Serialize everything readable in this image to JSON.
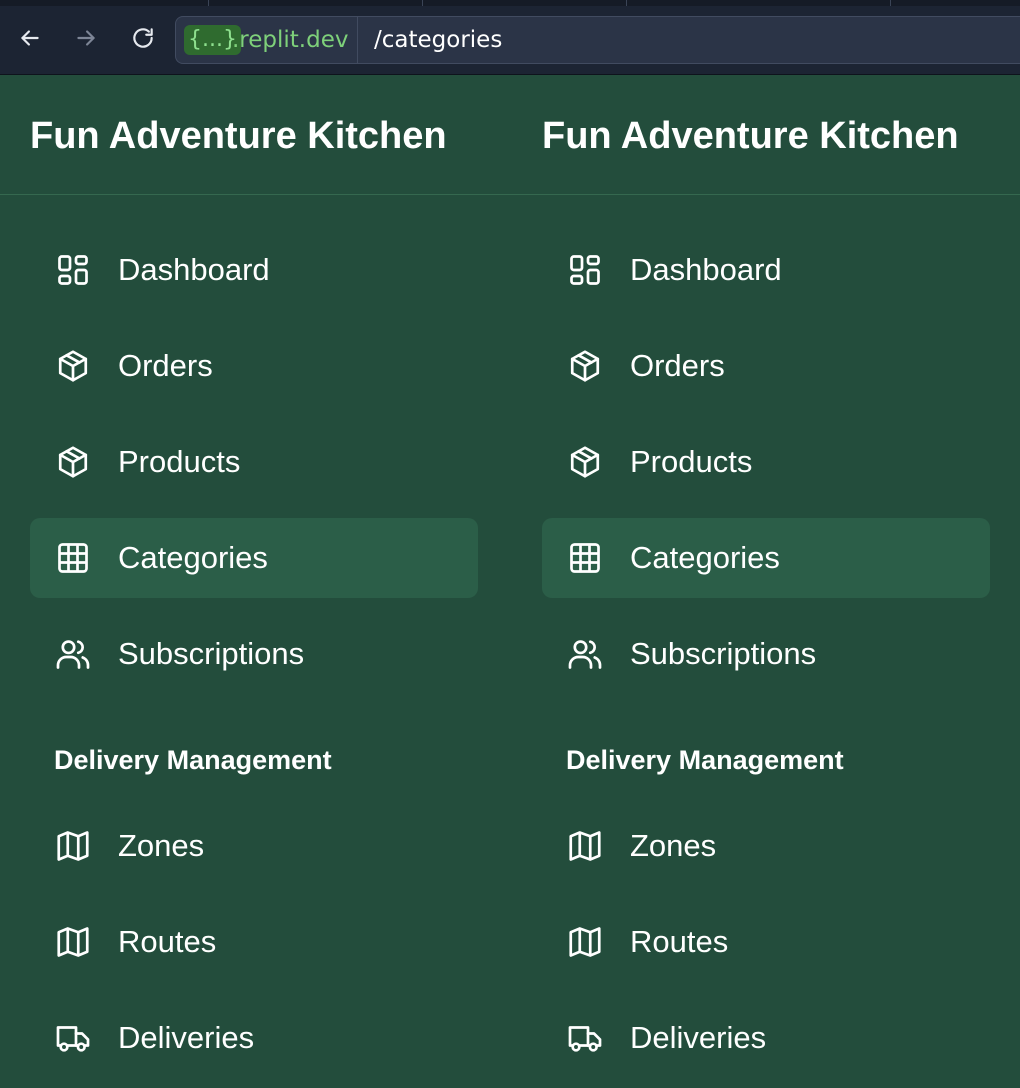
{
  "browser": {
    "url_chip": "{...}",
    "url_host": ".replit.dev",
    "url_path": "/categories",
    "back_icon": "arrow-left-icon",
    "forward_icon": "arrow-right-icon",
    "reload_icon": "reload-icon"
  },
  "panels": [
    {
      "title": "Fun Adventure Kitchen",
      "nav": [
        {
          "label": "Dashboard",
          "icon": "dashboard-icon",
          "active": false
        },
        {
          "label": "Orders",
          "icon": "package-icon",
          "active": false
        },
        {
          "label": "Products",
          "icon": "package-icon",
          "active": false
        },
        {
          "label": "Categories",
          "icon": "grid-icon",
          "active": true
        },
        {
          "label": "Subscriptions",
          "icon": "users-icon",
          "active": false
        }
      ],
      "section_heading": "Delivery Management",
      "delivery_nav": [
        {
          "label": "Zones",
          "icon": "map-icon",
          "active": false
        },
        {
          "label": "Routes",
          "icon": "map-icon",
          "active": false
        },
        {
          "label": "Deliveries",
          "icon": "truck-icon",
          "active": false
        }
      ]
    },
    {
      "title": "Fun Adventure Kitchen",
      "nav": [
        {
          "label": "Dashboard",
          "icon": "dashboard-icon",
          "active": false
        },
        {
          "label": "Orders",
          "icon": "package-icon",
          "active": false
        },
        {
          "label": "Products",
          "icon": "package-icon",
          "active": false
        },
        {
          "label": "Categories",
          "icon": "grid-icon",
          "active": true
        },
        {
          "label": "Subscriptions",
          "icon": "users-icon",
          "active": false
        }
      ],
      "section_heading": "Delivery Management",
      "delivery_nav": [
        {
          "label": "Zones",
          "icon": "map-icon",
          "active": false
        },
        {
          "label": "Routes",
          "icon": "map-icon",
          "active": false
        },
        {
          "label": "Deliveries",
          "icon": "truck-icon",
          "active": false
        }
      ]
    }
  ],
  "colors": {
    "sidebar_bg": "#234d3c",
    "active_item_bg": "#2b5e48",
    "chrome_bg": "#1c2433",
    "url_host": "#7ed07a"
  }
}
